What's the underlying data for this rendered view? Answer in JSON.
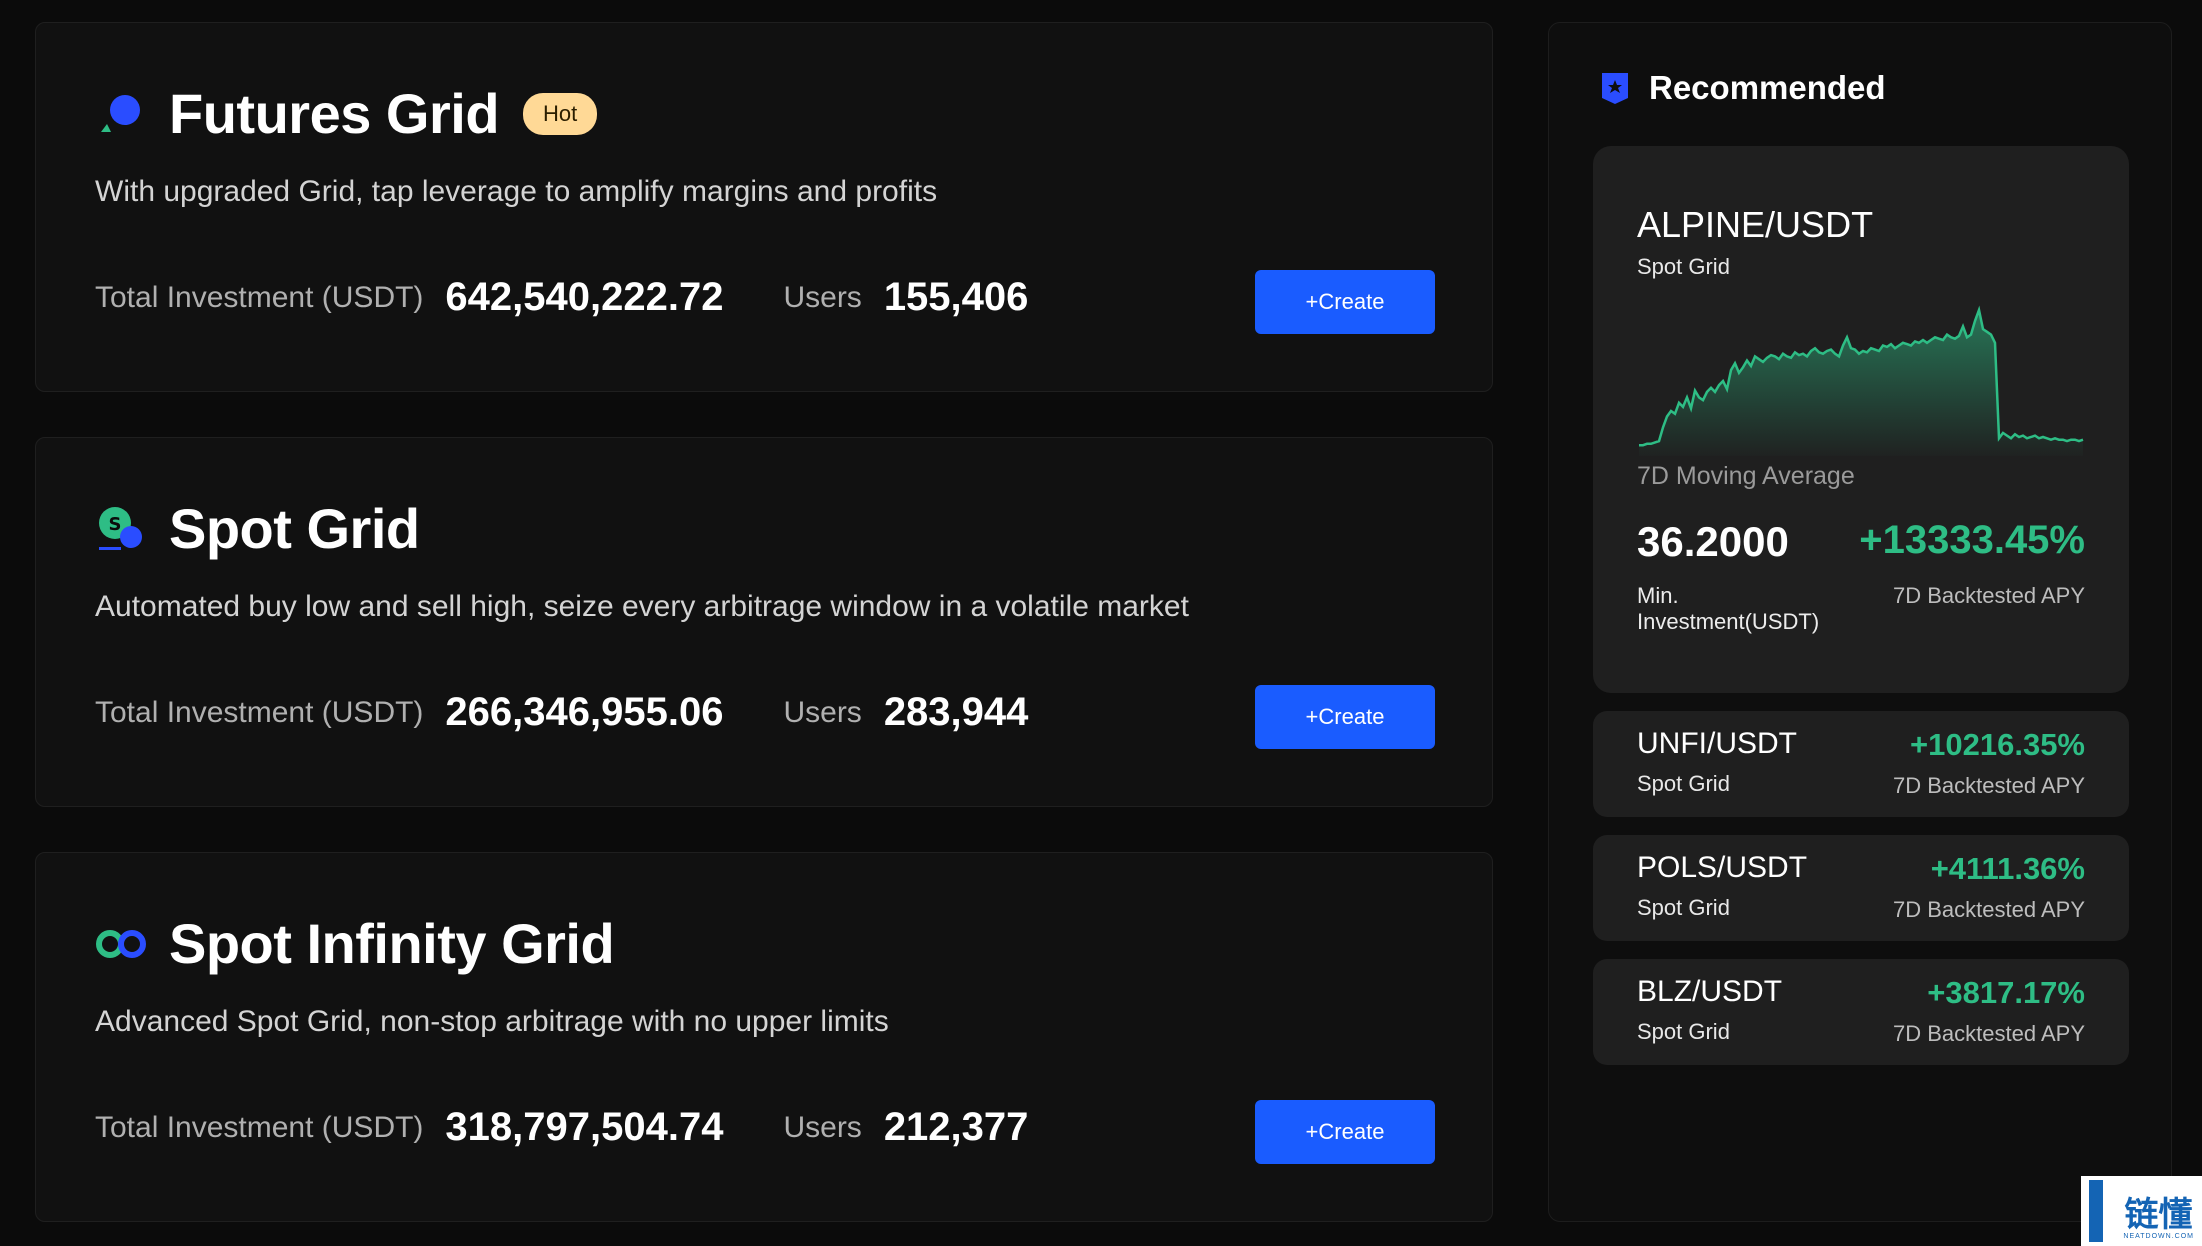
{
  "cards": [
    {
      "title": "Futures Grid",
      "badge": "Hot",
      "description": "With upgraded Grid, tap leverage to amplify margins and profits",
      "investment_label": "Total Investment (USDT)",
      "investment_value": "642,540,222.72",
      "users_label": "Users",
      "users_value": "155,406",
      "button": "+Create"
    },
    {
      "title": "Spot Grid",
      "description": "Automated buy low and sell high, seize every arbitrage window in a volatile market",
      "investment_label": "Total Investment (USDT)",
      "investment_value": "266,346,955.06",
      "users_label": "Users",
      "users_value": "283,944",
      "button": "+Create"
    },
    {
      "title": "Spot Infinity Grid",
      "description": "Advanced Spot Grid, non-stop arbitrage with no upper limits",
      "investment_label": "Total Investment (USDT)",
      "investment_value": "318,797,504.74",
      "users_label": "Users",
      "users_value": "212,377",
      "button": "+Create"
    }
  ],
  "recommended": {
    "title": "Recommended",
    "featured": {
      "pair": "ALPINE/USDT",
      "type": "Spot Grid",
      "chart_label": "7D Moving Average",
      "min_investment": "36.2000",
      "min_investment_label": "Min. Investment(USDT)",
      "apy": "+13333.45%",
      "apy_label": "7D Backtested APY"
    },
    "items": [
      {
        "pair": "UNFI/USDT",
        "type": "Spot Grid",
        "apy": "+10216.35%",
        "apy_label": "7D Backtested APY"
      },
      {
        "pair": "POLS/USDT",
        "type": "Spot Grid",
        "apy": "+4111.36%",
        "apy_label": "7D Backtested APY"
      },
      {
        "pair": "BLZ/USDT",
        "type": "Spot Grid",
        "apy": "+3817.17%",
        "apy_label": "7D Backtested APY"
      }
    ]
  },
  "watermark": {
    "text": "链懂",
    "sub": "NEATDOWN.COM"
  },
  "colors": {
    "accent": "#1a5cff",
    "positive": "#2ebd85",
    "badge": "#ffd996"
  },
  "icons": [
    "futures-grid-icon",
    "spot-grid-icon",
    "spot-infinity-grid-icon",
    "recommended-badge-icon"
  ],
  "sparkline": [
    5,
    5,
    6,
    6,
    7,
    8,
    18,
    26,
    30,
    28,
    36,
    33,
    40,
    32,
    45,
    40,
    38,
    44,
    47,
    44,
    49,
    52,
    46,
    60,
    65,
    58,
    62,
    67,
    63,
    70,
    68,
    66,
    69,
    71,
    70,
    68,
    72,
    70,
    69,
    73,
    71,
    72,
    70,
    74,
    76,
    73,
    72,
    74,
    75,
    72,
    70,
    78,
    84,
    76,
    75,
    72,
    74,
    73,
    76,
    75,
    74,
    78,
    77,
    79,
    76,
    78,
    80,
    79,
    78,
    81,
    80,
    82,
    80,
    82,
    84,
    83,
    82,
    86,
    84,
    83,
    85,
    92,
    84,
    86,
    96,
    104,
    90,
    88,
    86,
    80,
    10,
    14,
    12,
    10,
    13,
    11,
    12,
    10,
    11,
    12,
    10,
    11,
    10,
    9,
    10,
    9,
    9,
    8,
    9,
    9,
    8,
    9
  ]
}
